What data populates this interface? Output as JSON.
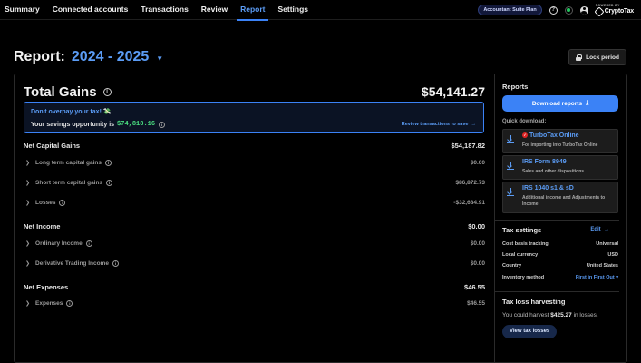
{
  "nav": {
    "items": [
      "Summary",
      "Connected accounts",
      "Transactions",
      "Review",
      "Report",
      "Settings"
    ],
    "active": "Report",
    "plan_badge": "Accountant Suite Plan",
    "logo_top": "POWERED BY",
    "logo_text": "CryptoTax"
  },
  "header": {
    "label": "Report:",
    "period": "2024 - 2025",
    "lock_label": "Lock period"
  },
  "gains": {
    "title": "Total Gains",
    "value": "$54,141.27"
  },
  "savings": {
    "title": "Don't overpay your tax!",
    "prefix": "Your savings opportunity is",
    "value": "$74,818.16",
    "link": "Review transactions to save"
  },
  "sections": [
    {
      "label": "Net Capital Gains",
      "value": "$54,187.82",
      "sub": [
        {
          "label": "Long term capital gains",
          "value": "$0.00"
        },
        {
          "label": "Short term capital gains",
          "value": "$86,872.73"
        },
        {
          "label": "Losses",
          "value": "-$32,684.91"
        }
      ]
    },
    {
      "label": "Net Income",
      "value": "$0.00",
      "sub": [
        {
          "label": "Ordinary Income",
          "value": "$0.00"
        },
        {
          "label": "Derivative Trading Income",
          "value": "$0.00"
        }
      ]
    },
    {
      "label": "Net Expenses",
      "value": "$46.55",
      "sub": [
        {
          "label": "Expenses",
          "value": "$46.55"
        }
      ]
    }
  ],
  "reports": {
    "title": "Reports",
    "download_label": "Download reports",
    "quick_title": "Quick download:",
    "quick": [
      {
        "name": "TurboTax Online",
        "desc": "For importing into TurboTax Online"
      },
      {
        "name": "IRS Form 8949",
        "desc": "Sales and other dispositions"
      },
      {
        "name": "IRS 1040 s1 & sD",
        "desc": "Additional income and Adjustments to Income"
      }
    ]
  },
  "tax_settings": {
    "title": "Tax settings",
    "edit": "Edit",
    "rows": [
      {
        "k": "Cost basis tracking",
        "v": "Universal"
      },
      {
        "k": "Local currency",
        "v": "USD"
      },
      {
        "k": "Country",
        "v": "United States"
      },
      {
        "k": "Inventory method",
        "v": "First in First Out"
      }
    ]
  },
  "harvest": {
    "title": "Tax loss harvesting",
    "text_prefix": "You could harvest",
    "amount": "$425.27",
    "text_suffix": "in losses.",
    "button": "View tax losses"
  },
  "colors": {
    "accent": "#3b82f6",
    "success": "#4ade80",
    "background": "#000000"
  },
  "icons": [
    "help-icon",
    "status-icon",
    "user-icon",
    "chevron-down-icon",
    "lock-icon",
    "info-icon",
    "money-icon",
    "arrow-right-icon",
    "chevron-right-icon",
    "download-icon",
    "turbotax-check-icon"
  ]
}
